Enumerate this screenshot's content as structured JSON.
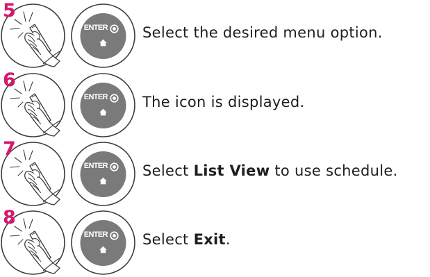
{
  "button": {
    "enter_label": "ENTER",
    "icon": "home-icon",
    "enter_icon": "circle-dot-icon"
  },
  "steps": [
    {
      "number": "5",
      "text_before": "Select the desired menu option.",
      "text_bold": "",
      "text_after": ""
    },
    {
      "number": "6",
      "text_before": "The icon is displayed.",
      "text_bold": "",
      "text_after": ""
    },
    {
      "number": "7",
      "text_before": "Select ",
      "text_bold": "List View",
      "text_after": " to use schedule."
    },
    {
      "number": "8",
      "text_before": "Select ",
      "text_bold": "Exit",
      "text_after": "."
    }
  ],
  "colors": {
    "step_number": "#d6176e",
    "button_fill": "#7a7a7a",
    "text": "#1e1e1e"
  }
}
